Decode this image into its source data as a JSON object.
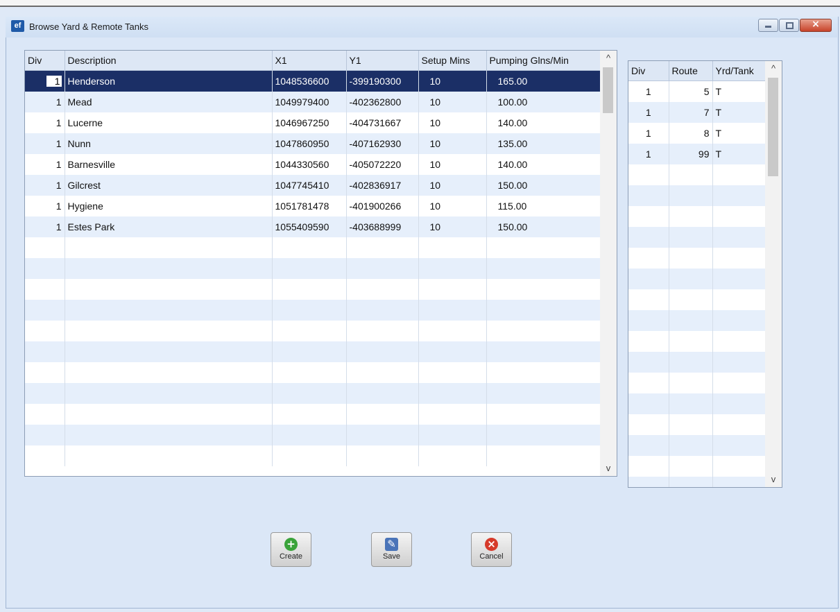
{
  "window": {
    "app_icon": "ef",
    "title": "Browse Yard & Remote Tanks",
    "controls": {
      "minimize_icon": "minimize-icon",
      "maximize_icon": "maximize-icon",
      "close_icon": "close-icon"
    }
  },
  "main_grid": {
    "columns": [
      "Div",
      "Description",
      "X1",
      "Y1",
      "Setup Mins",
      "Pumping Glns/Min"
    ],
    "rows": [
      {
        "div": "1",
        "description": "Henderson",
        "x1": "1048536600",
        "y1": "-399190300",
        "setup": "10",
        "pumping": "165.00"
      },
      {
        "div": "1",
        "description": "Mead",
        "x1": "1049979400",
        "y1": "-402362800",
        "setup": "10",
        "pumping": "100.00"
      },
      {
        "div": "1",
        "description": "Lucerne",
        "x1": "1046967250",
        "y1": "-404731667",
        "setup": "10",
        "pumping": "140.00"
      },
      {
        "div": "1",
        "description": "Nunn",
        "x1": "1047860950",
        "y1": "-407162930",
        "setup": "10",
        "pumping": "135.00"
      },
      {
        "div": "1",
        "description": "Barnesville",
        "x1": "1044330560",
        "y1": "-405072220",
        "setup": "10",
        "pumping": "140.00"
      },
      {
        "div": "1",
        "description": "Gilcrest",
        "x1": "1047745410",
        "y1": "-402836917",
        "setup": "10",
        "pumping": "150.00"
      },
      {
        "div": "1",
        "description": "Hygiene",
        "x1": "1051781478",
        "y1": "-401900266",
        "setup": "10",
        "pumping": "115.00"
      },
      {
        "div": "1",
        "description": "Estes Park",
        "x1": "1055409590",
        "y1": "-403688999",
        "setup": "10",
        "pumping": "150.00"
      }
    ],
    "selected_row": 0
  },
  "side_grid": {
    "columns": [
      "Div",
      "Route",
      "Yrd/Tank"
    ],
    "rows": [
      {
        "div": "1",
        "route": "5",
        "type": "T"
      },
      {
        "div": "1",
        "route": "7",
        "type": "T"
      },
      {
        "div": "1",
        "route": "8",
        "type": "T"
      },
      {
        "div": "1",
        "route": "99",
        "type": "T"
      }
    ]
  },
  "scroll": {
    "up": "^",
    "down": "v"
  },
  "buttons": {
    "create": {
      "label": "Create",
      "glyph": "+",
      "color": "#3aa33a"
    },
    "save": {
      "label": "Save",
      "glyph": "✎",
      "color": "#4a74b8"
    },
    "cancel": {
      "label": "Cancel",
      "glyph": "×",
      "color": "#d63a2a"
    }
  },
  "colors": {
    "selected_row": "#1b2f66",
    "alt_row": "#e6effb",
    "background": "#dbe7f7"
  }
}
